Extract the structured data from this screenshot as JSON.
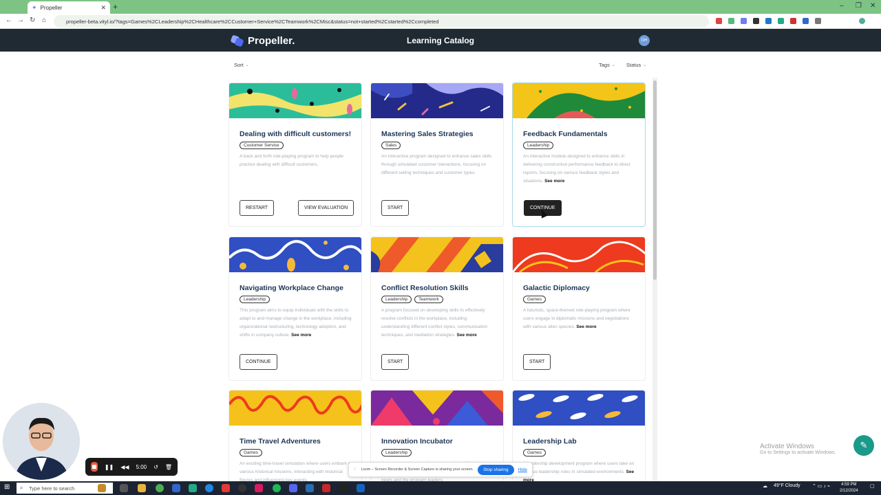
{
  "browser": {
    "tab_title": "Propeller",
    "url": "propeller-beta.vityl.io/?tags=Games%2CLeadership%2CHealthcare%2CCustomer+Service%2CTeamwork%2CMisc&status=not+started%2Cstarted%2Ccompleted"
  },
  "header": {
    "logo_text": "Propeller.",
    "page_title": "Learning Catalog",
    "avatar_initials": "GH"
  },
  "filters": {
    "sort_label": "Sort",
    "tags_label": "Tags",
    "status_label": "Status"
  },
  "cards": [
    {
      "title": "Dealing with difficult customers!",
      "tags": [
        "Customer Service"
      ],
      "description": "A back and forth role-playing program to help people practice dealing with difficult customers.",
      "see_more": "",
      "buttons": [
        "RESTART",
        "VIEW EVALUATION"
      ]
    },
    {
      "title": "Mastering Sales Strategies",
      "tags": [
        "Sales"
      ],
      "description": "An interactive program designed to enhance sales skills through simulated customer interactions, focusing on different selling techniques and customer types.",
      "see_more": "",
      "buttons": [
        "START"
      ]
    },
    {
      "title": "Feedback Fundamentals",
      "tags": [
        "Leadership"
      ],
      "description": "An interactive module designed to enhance skills in delivering constructive performance feedback to direct reports, focusing on various feedback styles and situations.",
      "see_more": "See more",
      "buttons": [
        "CONTINUE"
      ]
    },
    {
      "title": "Navigating Workplace Change",
      "tags": [
        "Leadership"
      ],
      "description": "This program aims to equip individuals with the skills to adapt to and manage change in the workplace, including organizational restructuring, technology adoption, and shifts in company culture.",
      "see_more": "See more",
      "buttons": [
        "CONTINUE"
      ]
    },
    {
      "title": "Conflict Resolution Skills",
      "tags": [
        "Leadership",
        "Teamwork"
      ],
      "description": "A program focused on developing skills to effectively resolve conflicts in the workplace, including understanding different conflict styles, communication techniques, and mediation strategies.",
      "see_more": "See more",
      "buttons": [
        "START"
      ]
    },
    {
      "title": "Galactic Diplomacy",
      "tags": [
        "Games"
      ],
      "description": "A futuristic, space-themed role-playing program where users engage in diplomatic missions and negotiations with various alien species.",
      "see_more": "See more",
      "buttons": [
        "START"
      ]
    },
    {
      "title": "Time Travel Adventures",
      "tags": [
        "Games"
      ],
      "description": "An exciting time-travel simulation where users embark on various historical missions, interacting with historical figures and influencing key events.",
      "see_more": "",
      "buttons": []
    },
    {
      "title": "Innovation Incubator",
      "tags": [
        "Leadership"
      ],
      "description": "A program designed to foster innovation skills, allowing users to pitch, develop and present new ideas to their peers and the program leaders.",
      "see_more": "",
      "buttons": []
    },
    {
      "title": "Leadership Lab",
      "tags": [
        "Games"
      ],
      "description": "A leadership development program where users take on various leadership roles in simulated environments.",
      "see_more": "See more",
      "buttons": []
    }
  ],
  "overlays": {
    "recorder_time": "5:00",
    "share_text": "Loom – Screen Recorder & Screen Capture is sharing your screen.",
    "stop_sharing": "Stop sharing",
    "hide": "Hide",
    "activate_title": "Activate Windows",
    "activate_sub": "Go to Settings to activate Windows."
  },
  "taskbar": {
    "search_placeholder": "Type here to search",
    "weather": "49°F  Cloudy",
    "time": "4:59 PM",
    "date": "2/12/2024"
  },
  "colors": {
    "header_bg": "#1f2a33",
    "title_color": "#1d3557",
    "tab_bar": "#7dc383"
  }
}
